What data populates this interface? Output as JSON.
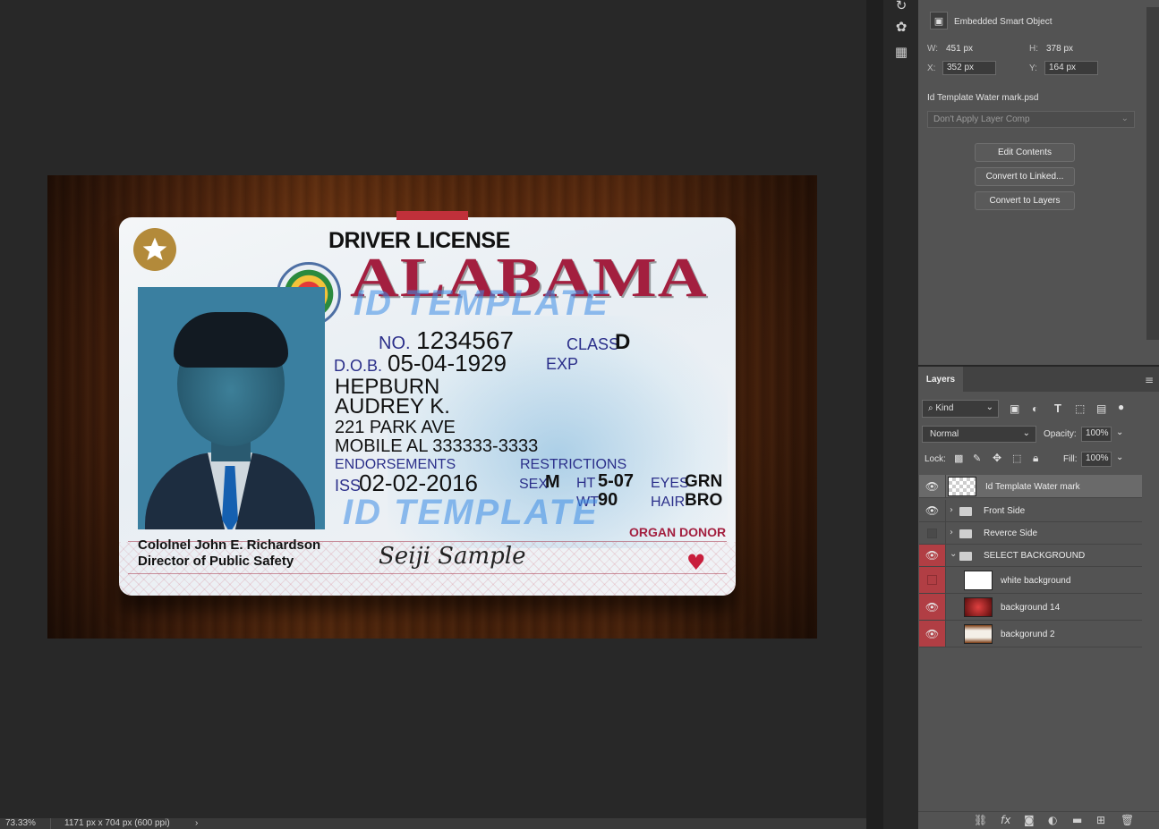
{
  "canvas": {
    "card": {
      "title": "DRIVER LICENSE",
      "state": "ALABAMA",
      "watermark": "ID TEMPLATE",
      "no_label": "NO.",
      "no_value": "1234567",
      "class_label": "CLASS",
      "class_value": "D",
      "dob_label": "D.O.B.",
      "dob_value": "05-04-1929",
      "exp_label": "EXP",
      "last_name": "HEPBURN",
      "first_name": "AUDREY K.",
      "address_line1": "221 PARK AVE",
      "address_line2": "MOBILE AL 333333-3333",
      "endorsements_label": "ENDORSEMENTS",
      "restrictions_label": "RESTRICTIONS",
      "iss_label": "ISS",
      "iss_value": "02-02-2016",
      "sex_label": "SEX",
      "sex_value": "M",
      "ht_label": "HT",
      "ht_value": "5-07",
      "wt_label": "WT",
      "wt_value": "90",
      "eyes_label": "EYES",
      "eyes_value": "GRN",
      "hair_label": "HAIR",
      "hair_value": "BRO",
      "organ_donor": "ORGAN DONOR",
      "director_name": "Cololnel John E. Richardson",
      "director_title": "Director of Public Safety",
      "signature": "Seiji Sample"
    }
  },
  "properties": {
    "header": "Embedded Smart Object",
    "w_label": "W:",
    "w_value": "451 px",
    "h_label": "H:",
    "h_value": "378 px",
    "x_label": "X:",
    "x_value": "352 px",
    "y_label": "Y:",
    "y_value": "164 px",
    "filename": "Id Templatе Water mark.psd",
    "layer_comp": "Don't Apply Layer Comp",
    "buttons": [
      "Edit Contents",
      "Convert to Linked...",
      "Convert to Layers"
    ]
  },
  "layers": {
    "tab": "Layers",
    "kind_label": "Kind",
    "blend_mode": "Normal",
    "opacity_label": "Opacity:",
    "opacity_value": "100%",
    "lock_label": "Lock:",
    "fill_label": "Fill:",
    "fill_value": "100%",
    "items": [
      {
        "name": "Id Templatе Water mark",
        "type": "smart"
      },
      {
        "name": "Front Side",
        "type": "group"
      },
      {
        "name": "Reverce Side",
        "type": "group"
      },
      {
        "name": "SELECT BACKGROUND",
        "type": "group-open"
      },
      {
        "name": "white background",
        "type": "layer"
      },
      {
        "name": "background 14",
        "type": "layer"
      },
      {
        "name": "backgorund 2",
        "type": "layer"
      }
    ]
  },
  "statusbar": {
    "zoom": "73.33%",
    "doc_info": "1171 px x 704 px (600 ppi)"
  },
  "colors": {
    "eye_red": "#b13e44",
    "panel_bg": "#535353",
    "workspace_bg": "#282828"
  }
}
